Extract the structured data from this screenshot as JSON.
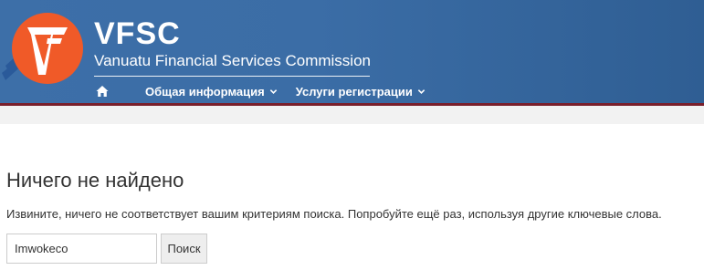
{
  "header": {
    "brand_title": "VFSC",
    "brand_subtitle": "Vanuatu Financial Services Commission",
    "logo_icon": "vfsc-logo-icon",
    "colors": {
      "header_bg": "#3d6fa8",
      "stripe": "#7a1f2b",
      "logo_orange": "#f05a28"
    }
  },
  "nav": {
    "home_icon": "home-icon",
    "items": [
      {
        "label": "Общая информация",
        "icon": "chevron-down-icon"
      },
      {
        "label": "Услуги регистрации",
        "icon": "chevron-down-icon"
      }
    ]
  },
  "main": {
    "title": "Ничего не найдено",
    "message": "Извините, ничего не соответствует вашим критериям поиска. Попробуйте ещё раз, используя другие ключевые слова.",
    "search": {
      "value": "Imwokeco",
      "button_label": "Поиск"
    }
  }
}
